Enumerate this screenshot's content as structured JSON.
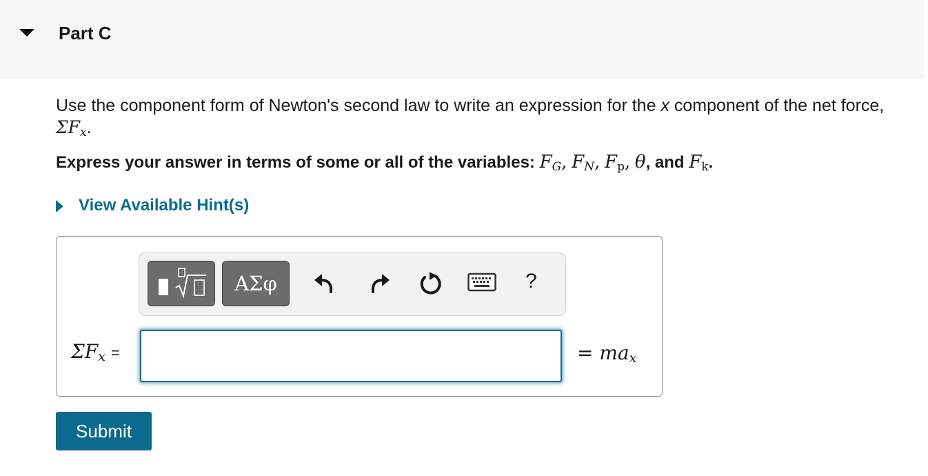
{
  "header": {
    "part_title": "Part C"
  },
  "question": {
    "text_before": "Use the component form of Newton's second law to write an expression for the",
    "var_x": "x",
    "text_after": "component of the net force,",
    "expr": "ΣF",
    "expr_sub": "x",
    "expr_end": "."
  },
  "instruction": {
    "lead": "Express your answer in terms of some or all of the variables:",
    "v1": "F",
    "v1_sub": "G",
    "comma1": ",",
    "v2": "F",
    "v2_sub": "N",
    "comma2": ",",
    "v3": "F",
    "v3_sub": "p",
    "comma3": ",",
    "v4": "θ",
    "and_text": ", and",
    "v5": "F",
    "v5_sub": "k",
    "end": "."
  },
  "hint": {
    "label": "View Available Hint(s)"
  },
  "toolbar": {
    "greek_label": "ΑΣφ",
    "help_label": "?"
  },
  "answer": {
    "lhs": "ΣF",
    "lhs_sub": "x",
    "lhs_eq": "=",
    "value": "",
    "rhs": "= ma",
    "rhs_sub": "x"
  },
  "submit": {
    "label": "Submit"
  },
  "colors": {
    "accent": "#0d6a8f",
    "header_bg": "#f6f6f6",
    "toolbar_button": "#6c6c6c"
  }
}
